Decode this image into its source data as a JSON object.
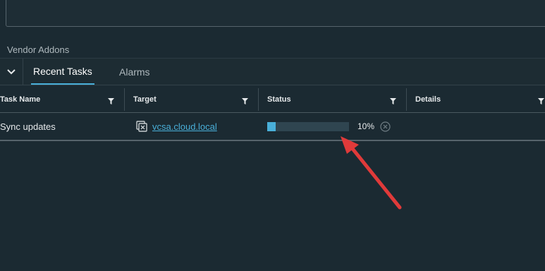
{
  "vendor_addons": {
    "label": "Vendor Addons"
  },
  "tabs": [
    {
      "label": "Recent Tasks",
      "active": true
    },
    {
      "label": "Alarms",
      "active": false
    }
  ],
  "table": {
    "columns": [
      "Task Name",
      "Target",
      "Status",
      "Details"
    ],
    "rows": [
      {
        "task_name": "Sync updates",
        "target": "vcsa.cloud.local",
        "target_icon": "vm-target-icon",
        "status_progress": 10,
        "status_text": "10%",
        "details": ""
      }
    ]
  },
  "colors": {
    "accent": "#49afd9",
    "annotation_arrow": "#e03a3a",
    "background": "#1b2a32"
  }
}
